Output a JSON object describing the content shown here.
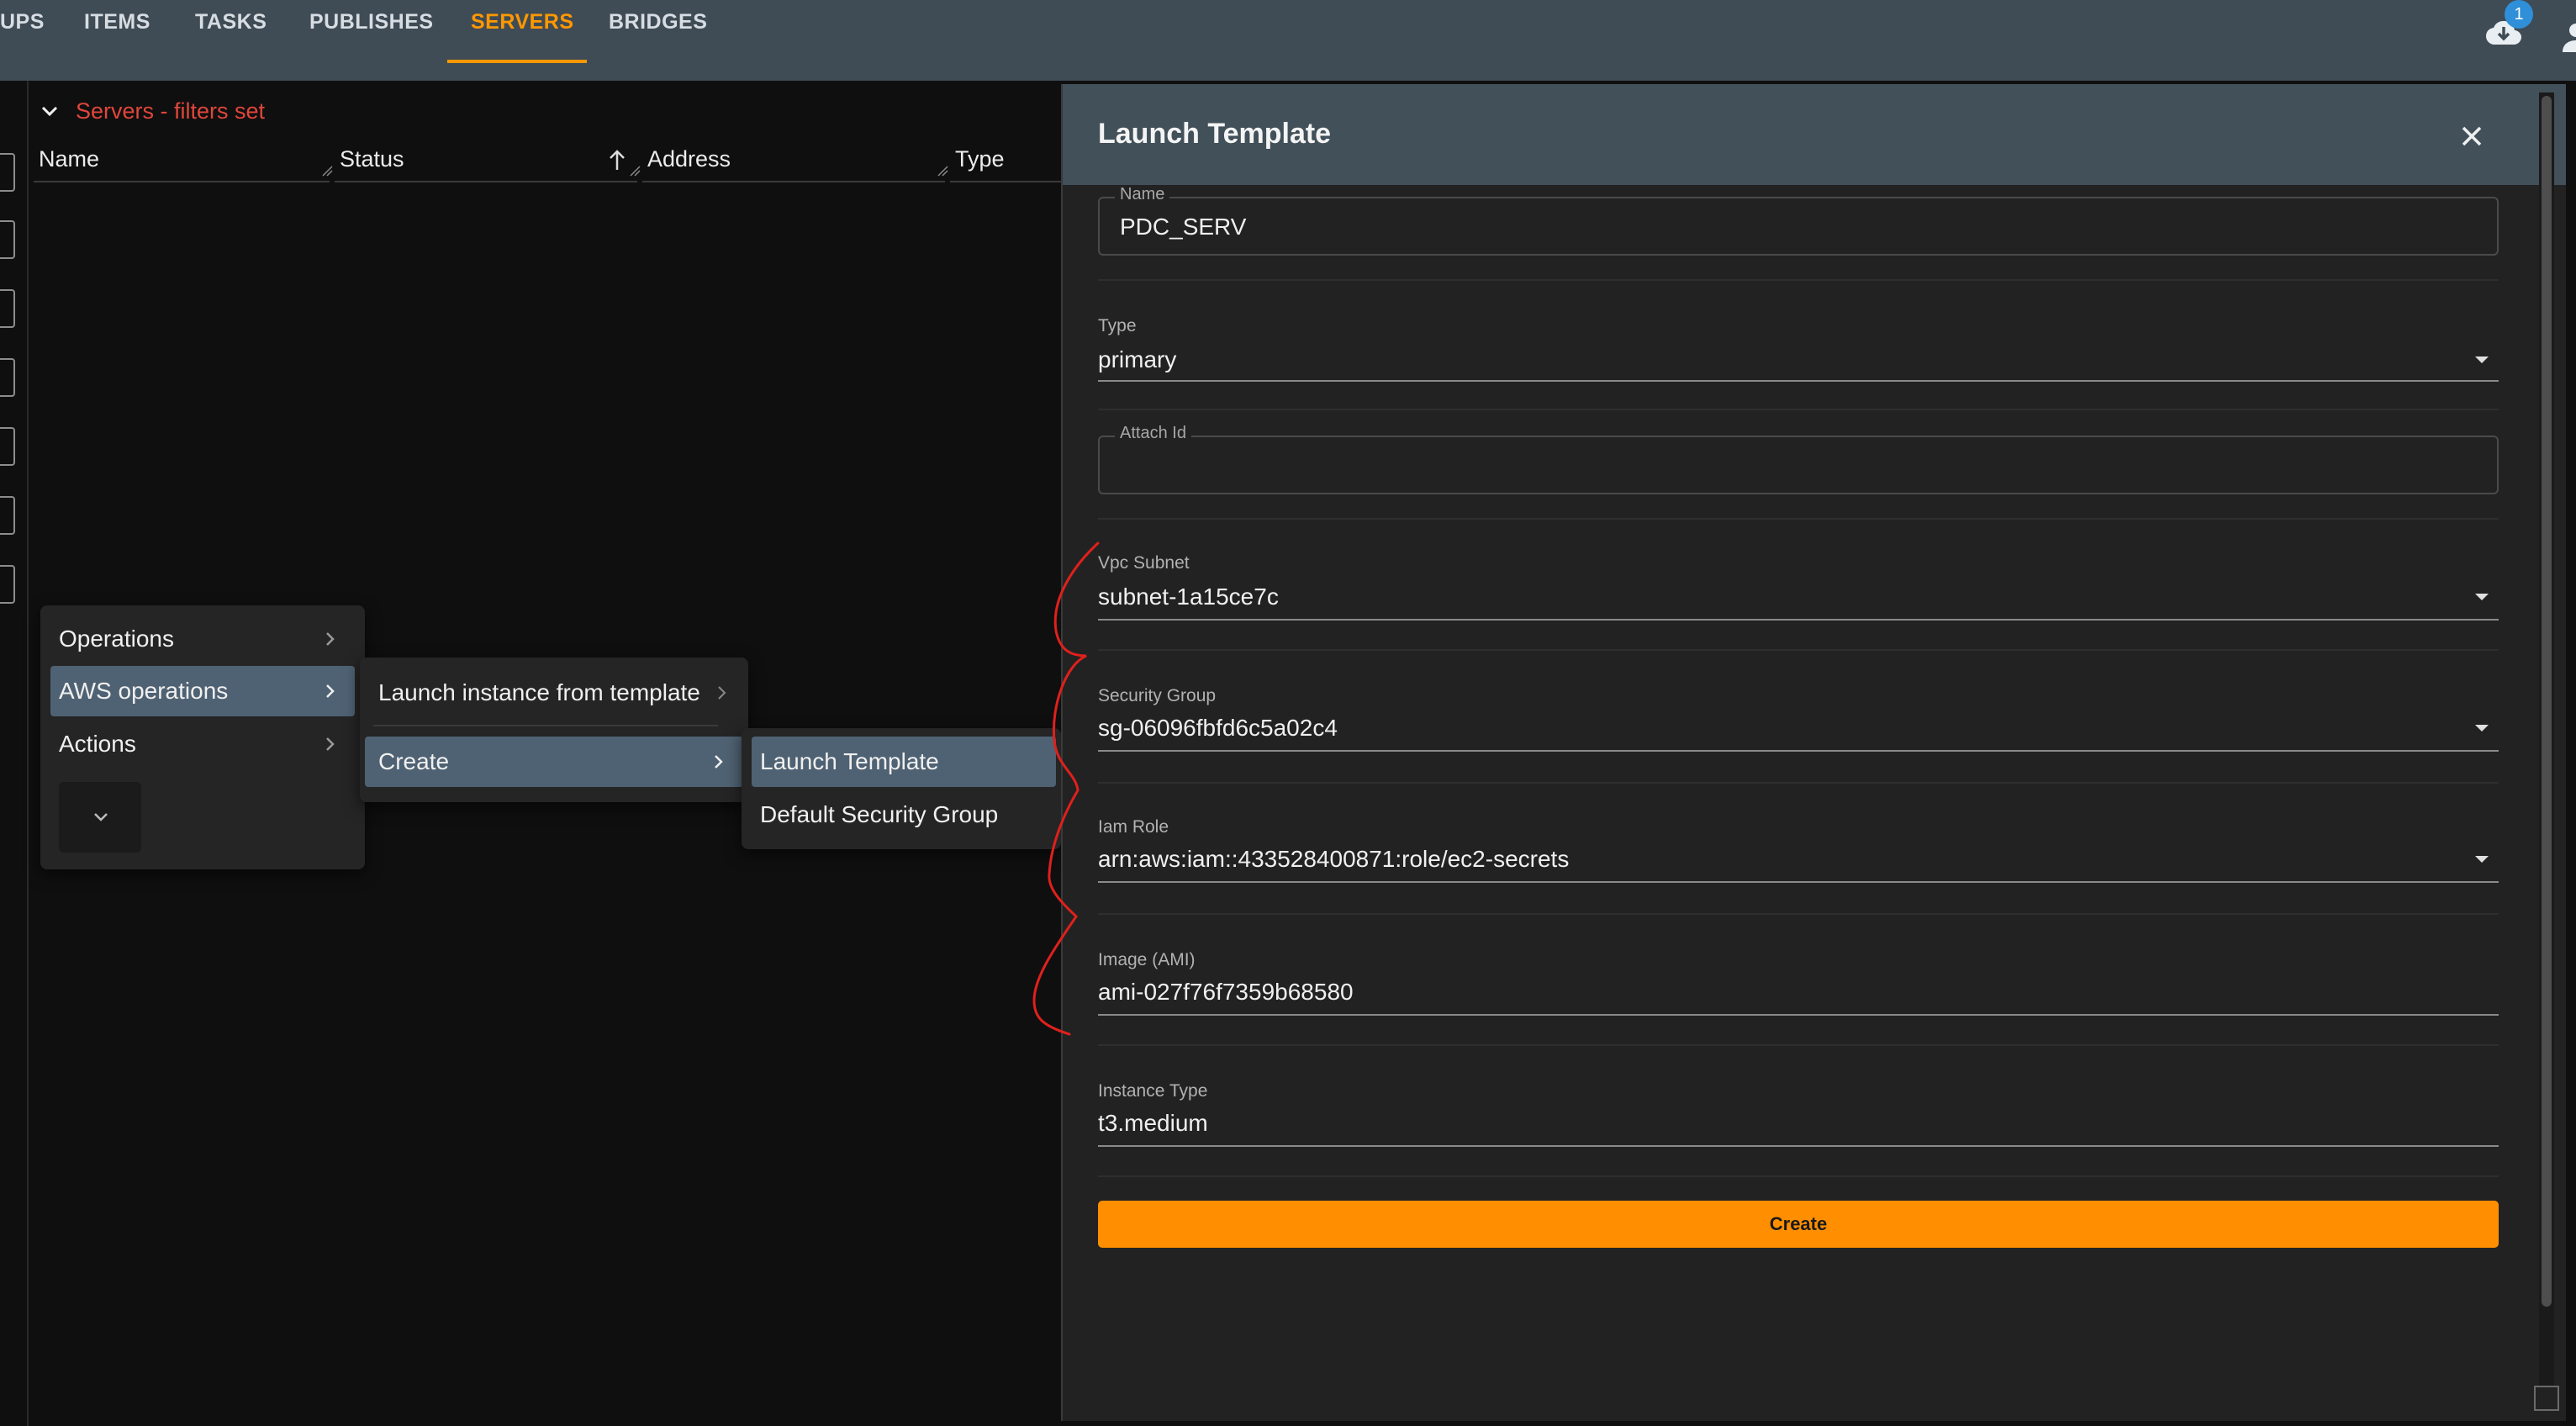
{
  "nav": {
    "tabs": [
      {
        "label": "UPS"
      },
      {
        "label": "ITEMS"
      },
      {
        "label": "TASKS"
      },
      {
        "label": "PUBLISHES"
      },
      {
        "label": "SERVERS",
        "active": true
      },
      {
        "label": "BRIDGES"
      }
    ],
    "download_badge": "1",
    "accent_color": "#ff9800"
  },
  "servers_panel": {
    "filter_text": "Servers - filters set",
    "columns": [
      "Name",
      "Status",
      "Address",
      "Type"
    ]
  },
  "context_menu": {
    "items": [
      "Operations",
      "AWS operations",
      "Actions"
    ],
    "submenu": [
      "Launch instance from template",
      "Create"
    ],
    "create_submenu": [
      "Launch Template",
      "Default Security Group"
    ]
  },
  "dialog": {
    "title": "Launch Template",
    "fields": {
      "name": {
        "label": "Name",
        "value": "PDC_SERV"
      },
      "type": {
        "label": "Type",
        "value": "primary"
      },
      "attach_id": {
        "label": "Attach Id",
        "value": ""
      },
      "vpc_subnet": {
        "label": "Vpc Subnet",
        "value": "subnet-1a15ce7c"
      },
      "security_group": {
        "label": "Security Group",
        "value": "sg-06096fbfd6c5a02c4"
      },
      "iam_role": {
        "label": "Iam Role",
        "value": "arn:aws:iam::433528400871:role/ec2-secrets"
      },
      "image": {
        "label": "Image (AMI)",
        "value": "ami-027f76f7359b68580"
      },
      "instance_type": {
        "label": "Instance Type",
        "value": "t3.medium"
      }
    },
    "create_label": "Create",
    "primary_color": "#ff8f00"
  }
}
